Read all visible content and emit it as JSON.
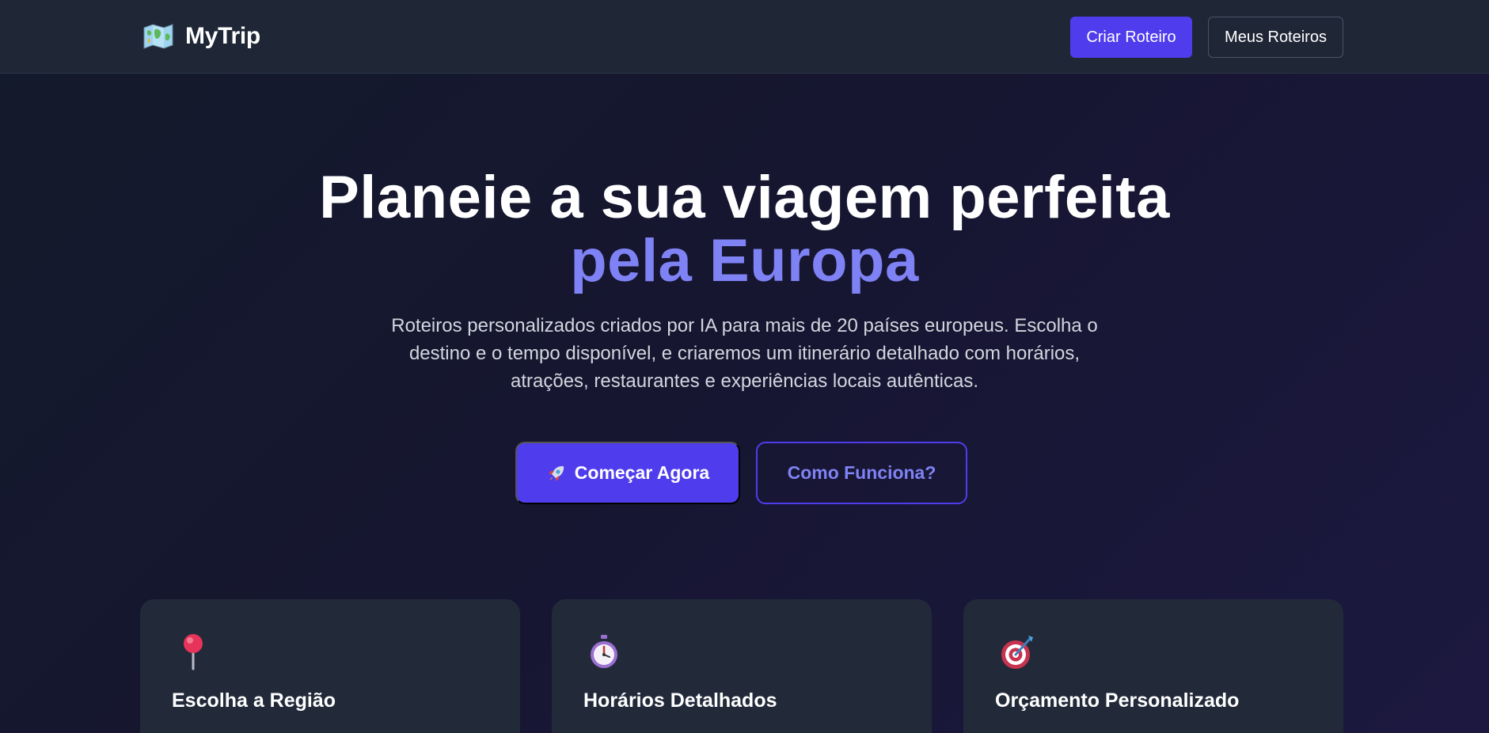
{
  "header": {
    "brand_name": "MyTrip",
    "brand_icon": "world-map-icon",
    "create_button": "Criar Roteiro",
    "my_trips_button": "Meus Roteiros"
  },
  "hero": {
    "title_line1": "Planeie a sua viagem perfeita",
    "title_line2": "pela Europa",
    "subtitle": "Roteiros personalizados criados por IA para mais de 20 países europeus. Escolha o destino e o tempo disponível, e criaremos um itinerário detalhado com horários, atrações, restaurantes e experiências locais autênticas.",
    "start_button": "Começar Agora",
    "start_icon": "rocket-icon",
    "how_button": "Como Funciona?"
  },
  "features": [
    {
      "icon": "round-pushpin-icon",
      "title": "Escolha a Região"
    },
    {
      "icon": "stopwatch-icon",
      "title": "Horários Detalhados"
    },
    {
      "icon": "target-icon",
      "title": "Orçamento Personalizado"
    }
  ],
  "colors": {
    "accent": "#4f3ded",
    "accent_light": "#7f82f4",
    "header_bg": "#1f2737",
    "card_bg": "#222a3a"
  }
}
